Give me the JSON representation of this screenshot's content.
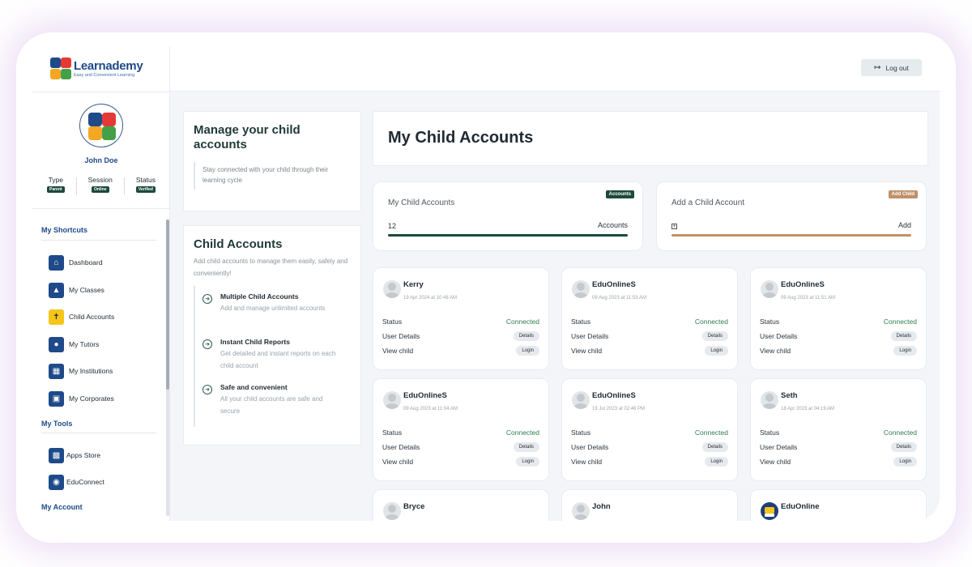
{
  "brand": {
    "name": "Learnademy",
    "tagline": "Easy and Convenient Learning"
  },
  "user": {
    "name": "John Doe",
    "meta": [
      {
        "label": "Type",
        "badge": "Parent"
      },
      {
        "label": "Session",
        "badge": "Online"
      },
      {
        "label": "Status",
        "badge": "Verified"
      }
    ]
  },
  "sidebar": {
    "shortcuts_title": "My Shortcuts",
    "shortcuts": [
      {
        "label": "Dashboard",
        "icon": "home-icon"
      },
      {
        "label": "My Classes",
        "icon": "graduation-cap-icon"
      },
      {
        "label": "Child Accounts",
        "icon": "child-icon",
        "active": true
      },
      {
        "label": "My Tutors",
        "icon": "user-icon"
      },
      {
        "label": "My Institutions",
        "icon": "institution-icon"
      },
      {
        "label": "My Corporates",
        "icon": "briefcase-icon"
      }
    ],
    "tools_title": "My Tools",
    "tools": [
      {
        "label": "Apps Store",
        "icon": "apps-icon"
      },
      {
        "label": "EduConnect",
        "icon": "users-icon"
      }
    ],
    "account_title": "My Account"
  },
  "topbar": {
    "logout_label": "Log out"
  },
  "info": {
    "manage_title": "Manage your child accounts",
    "manage_text": "Stay connected with your child through their learning cycle",
    "child_title": "Child Accounts",
    "child_sub": "Add child accounts to manage them easily, safely and conveniently!",
    "features": [
      {
        "title": "Multiple Child Accounts",
        "text": "Add and manage unlimited accounts"
      },
      {
        "title": "Instant Child Reports",
        "text": "Get detailed and instant reports on each child account"
      },
      {
        "title": "Safe and convenient",
        "text": "All your child accounts are safe and secure"
      }
    ]
  },
  "main": {
    "title": "My Child Accounts",
    "stats": [
      {
        "title": "My Child Accounts",
        "tag": "Accounts",
        "value": "12",
        "unit": "Accounts",
        "color": "#1d4a3a"
      },
      {
        "title": "Add a Child Account",
        "tag": "Add Child",
        "value": "+",
        "unit": "Add",
        "color": "#c09068"
      }
    ],
    "row_labels": {
      "status": "Status",
      "details": "User Details",
      "view": "View child",
      "details_btn": "Details",
      "login_btn": "Login"
    },
    "children": [
      {
        "name": "Kerry",
        "date": "19 Apr 2024 at 10:48 AM",
        "status": "Connected"
      },
      {
        "name": "EduOnlineS",
        "date": "09 Aug 2023 at 11:53 AM",
        "status": "Connected"
      },
      {
        "name": "EduOnlineS",
        "date": "09 Aug 2023 at 11:51 AM",
        "status": "Connected"
      },
      {
        "name": "EduOnlineS",
        "date": "09 Aug 2023 at 11:04 AM",
        "status": "Connected"
      },
      {
        "name": "EduOnlineS",
        "date": "19 Jul 2023 at 02:46 PM",
        "status": "Connected"
      },
      {
        "name": "Seth",
        "date": "18 Apr 2023 at 04:19 AM",
        "status": "Connected"
      },
      {
        "name": "Bryce",
        "date": "",
        "status": ""
      },
      {
        "name": "John",
        "date": "",
        "status": ""
      },
      {
        "name": "EduOnline",
        "date": "",
        "status": "",
        "institution": true
      }
    ]
  }
}
